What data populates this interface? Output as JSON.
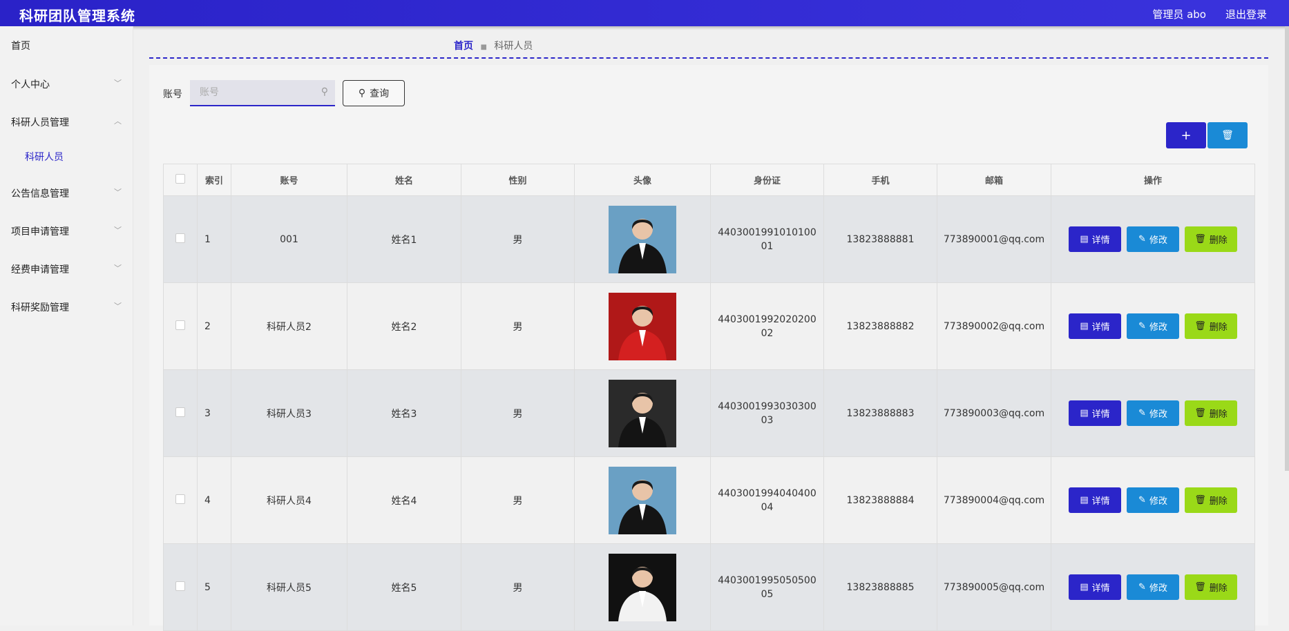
{
  "header": {
    "title": "科研团队管理系统",
    "admin": "管理员 abo",
    "logout": "退出登录"
  },
  "sidebar": {
    "items": [
      {
        "label": "首页"
      },
      {
        "label": "个人中心"
      },
      {
        "label": "科研人员管理"
      },
      {
        "label": "公告信息管理"
      },
      {
        "label": "项目申请管理"
      },
      {
        "label": "经费申请管理"
      },
      {
        "label": "科研奖励管理"
      }
    ],
    "sub_item": "科研人员"
  },
  "breadcrumb": {
    "home": "首页",
    "current": "科研人员"
  },
  "search": {
    "label": "账号",
    "placeholder": "账号",
    "query_label": "查询"
  },
  "toolbar": {
    "add_label": "+"
  },
  "table": {
    "headers": [
      "索引",
      "账号",
      "姓名",
      "性别",
      "头像",
      "身份证",
      "手机",
      "邮箱",
      "操作"
    ],
    "actions": {
      "detail": "详情",
      "edit": "修改",
      "delete": "删除"
    },
    "rows": [
      {
        "index": "1",
        "account": "001",
        "name": "姓名1",
        "gender": "男",
        "id_card": "440300199101010001",
        "phone": "13823888881",
        "email": "773890001@qq.com",
        "avatar_color": "#6aa0c4"
      },
      {
        "index": "2",
        "account": "科研人员2",
        "name": "姓名2",
        "gender": "男",
        "id_card": "440300199202020002",
        "phone": "13823888882",
        "email": "773890002@qq.com",
        "avatar_color": "#b01818"
      },
      {
        "index": "3",
        "account": "科研人员3",
        "name": "姓名3",
        "gender": "男",
        "id_card": "440300199303030003",
        "phone": "13823888883",
        "email": "773890003@qq.com",
        "avatar_color": "#2a2a2a"
      },
      {
        "index": "4",
        "account": "科研人员4",
        "name": "姓名4",
        "gender": "男",
        "id_card": "440300199404040004",
        "phone": "13823888884",
        "email": "773890004@qq.com",
        "avatar_color": "#6aa0c4"
      },
      {
        "index": "5",
        "account": "科研人员5",
        "name": "姓名5",
        "gender": "男",
        "id_card": "440300199505050005",
        "phone": "13823888885",
        "email": "773890005@qq.com",
        "avatar_color": "#111111"
      }
    ]
  },
  "colors": {
    "primary": "#2b25c9",
    "info": "#1a8ad6",
    "success": "#9ad918"
  }
}
